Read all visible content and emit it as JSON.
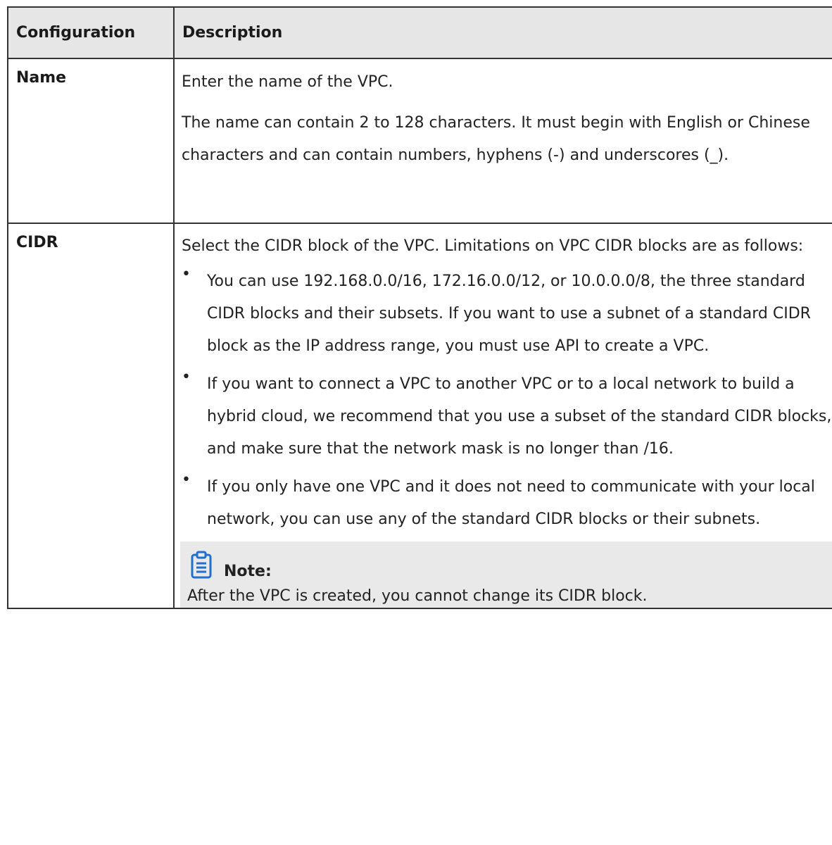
{
  "table": {
    "headers": {
      "configuration": "Configuration",
      "description": "Description"
    },
    "rows": [
      {
        "configuration": "Name",
        "description": {
          "first": "Enter the name of the VPC.",
          "body": "The name can contain 2 to 128 characters. It must begin with English or Chinese characters and can contain numbers, hyphens (-) and underscores (_)."
        }
      },
      {
        "configuration": "CIDR",
        "description": {
          "intro": "Select the CIDR block of the VPC. Limitations on VPC CIDR blocks are as follows:",
          "bullets": [
            "You can use 192.168.0.0/16, 172.16.0.0/12, or 10.0.0.0/8, the three standard CIDR blocks and their subsets. If you want to use a subnet of a standard CIDR block as the IP address range, you must use API to create a VPC.",
            "If you want to connect a VPC to another VPC or to a local network to build a hybrid cloud, we recommend that you use a subset of the standard CIDR blocks, and make sure that the network mask is no longer than /16.",
            "If you only have one VPC and it does not need to communicate with your local network, you can use any of the standard CIDR blocks or their subnets."
          ],
          "bullet_symbol": "•",
          "note": {
            "icon": "clipboard-icon",
            "title": "Note:",
            "text": "After the VPC is created, you cannot change its CIDR block."
          }
        }
      }
    ]
  },
  "colors": {
    "accent": "#1f6fd1",
    "header_bg": "#e6e6e6",
    "note_bg": "#e9e9e9",
    "border": "#333333"
  }
}
